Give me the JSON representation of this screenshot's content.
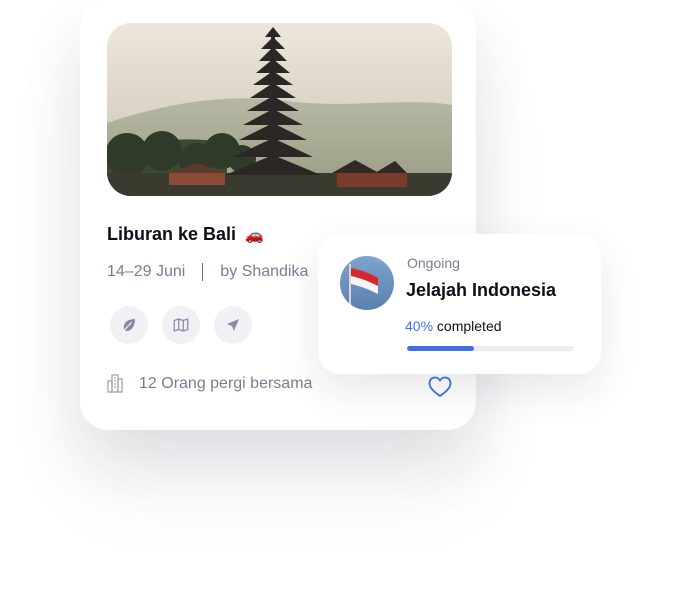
{
  "trip": {
    "title": "Liburan ke Bali",
    "title_emoji": "🚗",
    "dates": "14–29 Juni",
    "author": "by Shandika",
    "actions": [
      {
        "icon": "leaf-icon"
      },
      {
        "icon": "map-icon"
      },
      {
        "icon": "navigation-arrow-icon"
      }
    ],
    "participants": "12 Orang pergi bersama",
    "participants_icon": "building-icon",
    "favorite_icon": "heart-icon"
  },
  "progress_card": {
    "status": "Ongoing",
    "title": "Jelajah Indonesia",
    "percent_label": "40%",
    "completed_label": " completed",
    "progress": 0.4,
    "avatar_icon": "indonesia-flag-icon"
  },
  "colors": {
    "accent": "#3f6fe6",
    "text_primary": "#0f0f1a",
    "text_secondary": "#7c7c96",
    "button_bg": "#f1f1f5",
    "flag_red": "#d9262c"
  }
}
